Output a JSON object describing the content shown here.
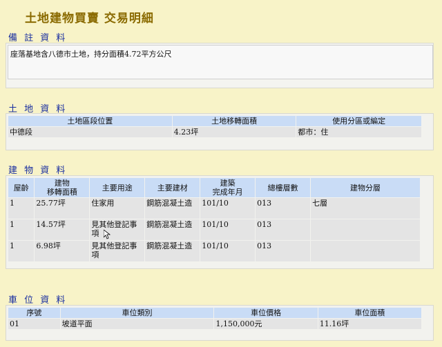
{
  "page_title": "土地建物買賣  交易明細",
  "remarks": {
    "title": "備 註 資 料",
    "text": "座落基地含八德市土地，持分面積4.72平方公尺"
  },
  "land": {
    "title": "土 地 資 料",
    "headers": [
      "土地區段位置",
      "土地移轉面積",
      "使用分區或編定"
    ],
    "rows": [
      [
        "中德段",
        "4.23坪",
        "都市：住"
      ]
    ]
  },
  "building": {
    "title": "建 物 資 料",
    "headers": [
      "屋齡",
      "建物\n移轉面積",
      "主要用途",
      "主要建材",
      "建築\n完成年月",
      "總樓層數",
      "建物分層"
    ],
    "rows": [
      [
        "1",
        "25.77坪",
        "住家用",
        "鋼筋混凝土造",
        "101/10",
        "013",
        "七層"
      ],
      [
        "1",
        "14.57坪",
        "見其他登記事項",
        "鋼筋混凝土造",
        "101/10",
        "013",
        ""
      ],
      [
        "1",
        "6.98坪",
        "見其他登記事項",
        "鋼筋混凝土造",
        "101/10",
        "013",
        ""
      ]
    ]
  },
  "parking": {
    "title": "車 位 資 料",
    "headers": [
      "序號",
      "車位類別",
      "車位價格",
      "車位面積"
    ],
    "rows": [
      [
        "01",
        "坡道平面",
        "1,150,000元",
        "11.16坪"
      ]
    ]
  }
}
